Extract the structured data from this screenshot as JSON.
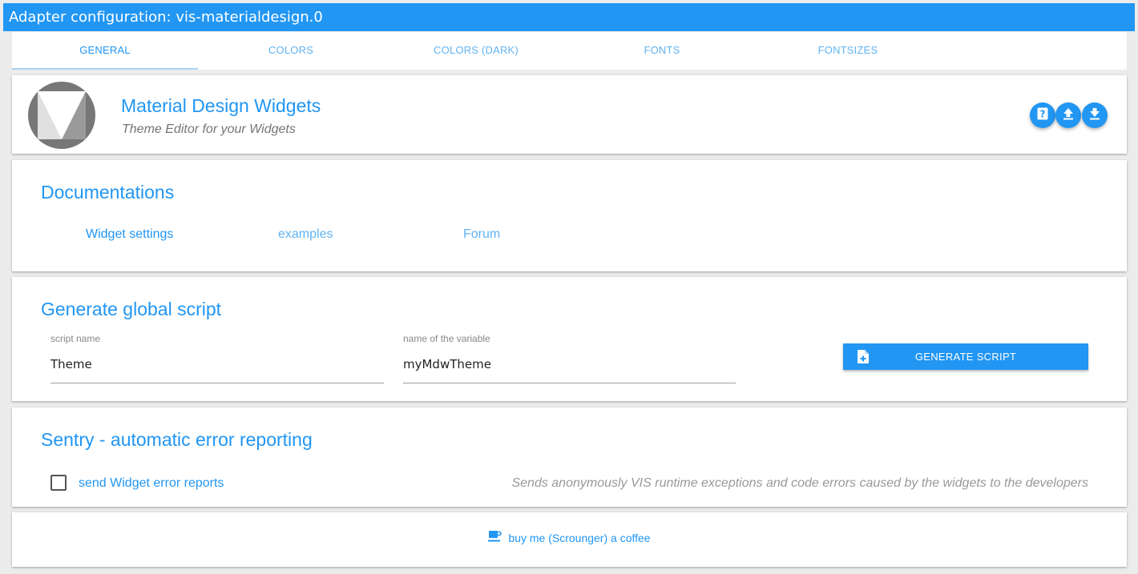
{
  "window": {
    "title": "Adapter configuration: vis-materialdesign.0"
  },
  "tabs": [
    {
      "label": "GENERAL"
    },
    {
      "label": "COLORS"
    },
    {
      "label": "COLORS (DARK)"
    },
    {
      "label": "FONTS"
    },
    {
      "label": "FONTSIZES"
    }
  ],
  "header": {
    "title": "Material Design Widgets",
    "subtitle": "Theme Editor for your Widgets",
    "actions": [
      "help-icon",
      "upload-icon",
      "download-icon"
    ]
  },
  "documentation": {
    "title": "Documentations",
    "links": [
      {
        "label": "Widget settings"
      },
      {
        "label": "examples"
      },
      {
        "label": "Forum"
      }
    ]
  },
  "script": {
    "title": "Generate global script",
    "name_label": "script name",
    "name_value": "Theme",
    "variable_label": "name of the variable",
    "variable_value": "myMdwTheme",
    "button_label": "GENERATE SCRIPT",
    "button_icon": "file-plus-icon"
  },
  "sentry": {
    "title": "Sentry - automatic error reporting",
    "checkbox_label": "send Widget error reports",
    "checked": false,
    "description": "Sends anonymously VIS runtime exceptions and code errors caused by the widgets to the developers"
  },
  "footer": {
    "coffee_label": "buy me (Scrounger) a coffee",
    "coffee_icon": "coffee-icon"
  },
  "colors": {
    "accent": "#2196f3",
    "accent_light": "#61b3f1",
    "background": "#ececec"
  }
}
